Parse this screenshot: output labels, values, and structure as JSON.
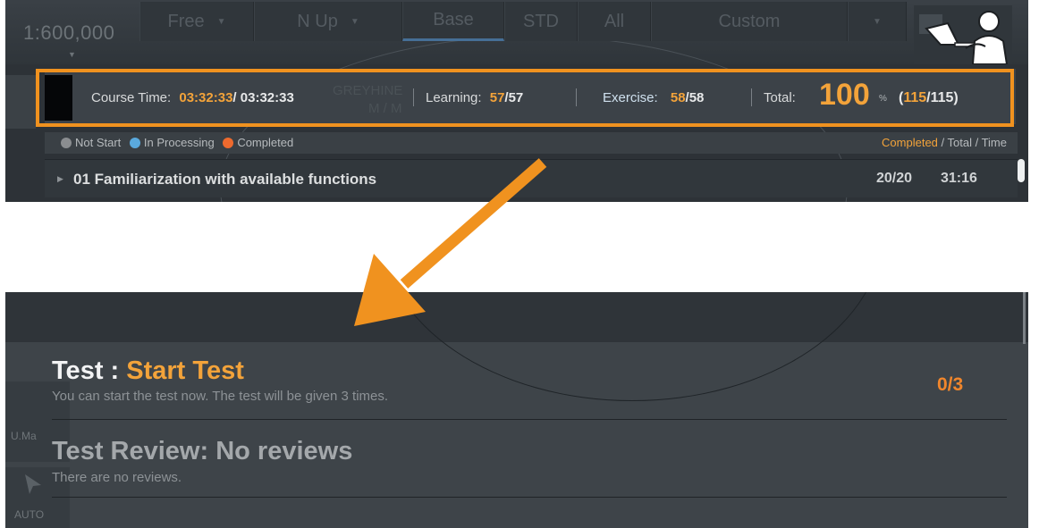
{
  "toolbar": {
    "scale": "1:600,000",
    "buttons": [
      {
        "label": "Free"
      },
      {
        "label": "N Up"
      },
      {
        "label": "Base"
      },
      {
        "label": "STD"
      },
      {
        "label": "All"
      },
      {
        "label": "Custom"
      }
    ]
  },
  "course": {
    "time_label": "Course Time:",
    "time_done": "03:32:33",
    "time_sep": "/ ",
    "time_total": "03:32:33",
    "learning_label": "Learning:",
    "learning_done": "57",
    "learning_total": "57",
    "exercise_label": "Exercise:",
    "exercise_done": "58",
    "exercise_total": "58",
    "total_label": "Total:",
    "total_percent": "100",
    "percent_sign": "%",
    "total_done": "115",
    "total_all": "115"
  },
  "legend": {
    "not_start": "Not Start",
    "in_processing": "In Processing",
    "completed": "Completed",
    "right_completed": "Completed",
    "right_rest": " / Total / Time",
    "colors": {
      "not_start": "#8a8d90",
      "in_processing": "#5aa9dd",
      "completed": "#ee6a2e"
    }
  },
  "module": {
    "title": "01 Familiarization with available functions",
    "count": "20/20",
    "time": "31:16"
  },
  "test": {
    "prefix": "Test : ",
    "action": "Start Test",
    "description": "You can start the test now. The test will be given 3 times.",
    "count": "0/3"
  },
  "review": {
    "title": "Test Review: No reviews",
    "description": "There are no reviews."
  },
  "colors": {
    "accent": "#f0921f",
    "panel": "#3e4449"
  }
}
